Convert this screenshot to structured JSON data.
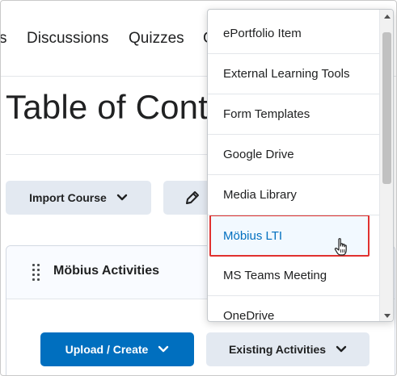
{
  "nav": {
    "partial_left": "s",
    "discussions": "Discussions",
    "quizzes": "Quizzes",
    "partial_right": "C"
  },
  "page": {
    "title": "Table of Conte"
  },
  "toolbar": {
    "import_course": "Import Course"
  },
  "module": {
    "title": "Möbius Activities",
    "upload_create": "Upload / Create",
    "existing_activities": "Existing Activities"
  },
  "dropdown": {
    "items": [
      {
        "label": "ePortfolio Item"
      },
      {
        "label": "External Learning Tools"
      },
      {
        "label": "Form Templates"
      },
      {
        "label": "Google Drive"
      },
      {
        "label": "Media Library"
      },
      {
        "label": "Möbius LTI"
      },
      {
        "label": "MS Teams Meeting"
      },
      {
        "label": "OneDrive"
      }
    ],
    "selected_index": 5,
    "scroll_position": 0.0
  },
  "colors": {
    "primary": "#006fbf",
    "highlight_border": "#e0312f",
    "secondary_button": "#e3e9f1",
    "text": "#202122"
  },
  "icons": {
    "chevron": "chevron-down-icon",
    "edit": "pencil-icon",
    "drag": "drag-handle-icon",
    "cursor": "hand-pointer-icon"
  }
}
